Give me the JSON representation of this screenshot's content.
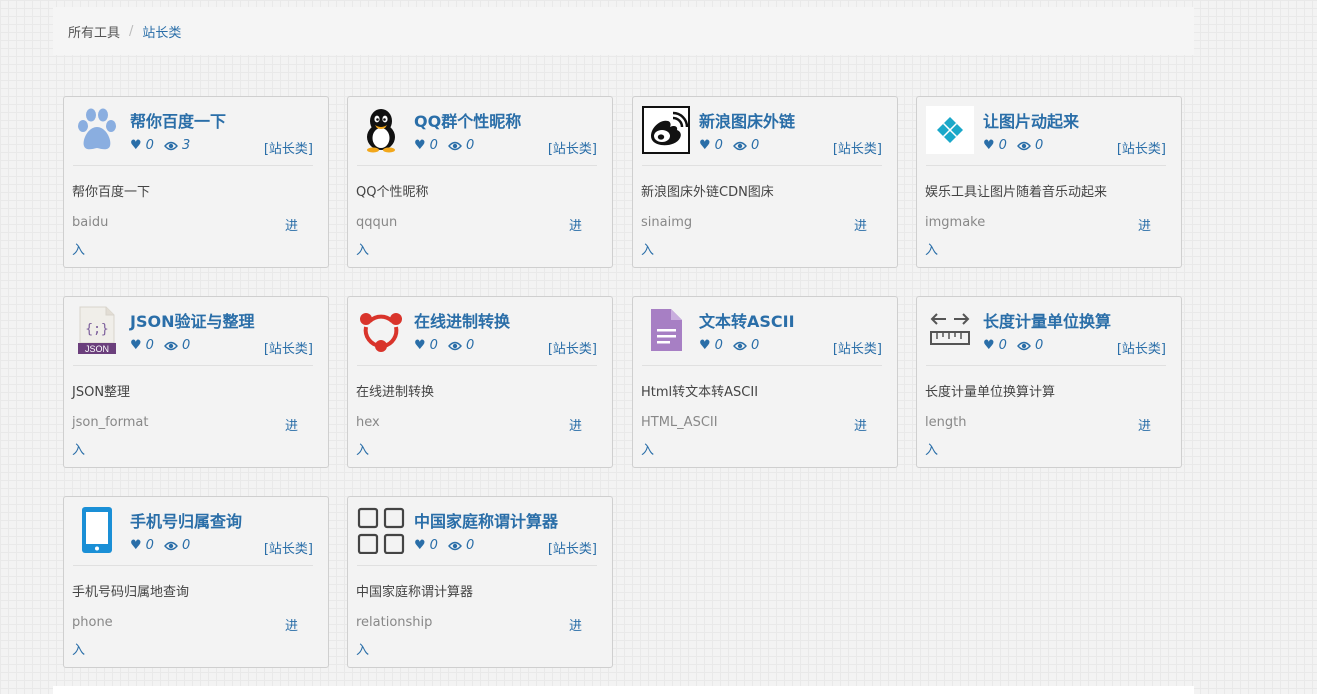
{
  "breadcrumb": {
    "root": "所有工具",
    "separator": "/",
    "current": "站长类"
  },
  "enter_label": [
    "进",
    "入"
  ],
  "tools": [
    {
      "title": "帮你百度一下",
      "likes": "0",
      "views": "3",
      "category": "[站长类]",
      "desc": "帮你百度一下",
      "slug": "baidu",
      "icon": "baidu-paw-icon"
    },
    {
      "title": "QQ群个性昵称",
      "likes": "0",
      "views": "0",
      "category": "[站长类]",
      "desc": "QQ个性昵称",
      "slug": "qqqun",
      "icon": "qq-penguin-icon"
    },
    {
      "title": "新浪图床外链",
      "likes": "0",
      "views": "0",
      "category": "[站长类]",
      "desc": "新浪图床外链CDN图床",
      "slug": "sinaimg",
      "icon": "weibo-icon"
    },
    {
      "title": "让图片动起来",
      "likes": "0",
      "views": "0",
      "category": "[站长类]",
      "desc": "娱乐工具让图片随着音乐动起来",
      "slug": "imgmake",
      "icon": "diamond-icon"
    },
    {
      "title": "JSON验证与整理",
      "likes": "0",
      "views": "0",
      "category": "[站长类]",
      "desc": "JSON整理",
      "slug": "json_format",
      "icon": "json-file-icon",
      "icon_text": "JSON",
      "icon_braces": "{;}"
    },
    {
      "title": "在线进制转换",
      "likes": "0",
      "views": "0",
      "category": "[站长类]",
      "desc": "在线进制转换",
      "slug": "hex",
      "icon": "share-triangle-icon"
    },
    {
      "title": "文本转ASCII",
      "likes": "0",
      "views": "0",
      "category": "[站长类]",
      "desc": "Html转文本转ASCII",
      "slug": "HTML_ASCII",
      "icon": "document-icon"
    },
    {
      "title": "长度计量单位换算",
      "likes": "0",
      "views": "0",
      "category": "[站长类]",
      "desc": "长度计量单位换算计算",
      "slug": "length",
      "icon": "ruler-icon"
    },
    {
      "title": "手机号归属查询",
      "likes": "0",
      "views": "0",
      "category": "[站长类]",
      "desc": "手机号码归属地查询",
      "slug": "phone",
      "icon": "mobile-phone-icon"
    },
    {
      "title": "中国家庭称谓计算器",
      "likes": "0",
      "views": "0",
      "category": "[站长类]",
      "desc": "中国家庭称谓计算器",
      "slug": "relationship",
      "icon": "grid-squares-icon"
    }
  ],
  "colors": {
    "link": "#2a6ea8",
    "baidu": "#8aaee0",
    "hex_red": "#d9342b",
    "doc_purple": "#a77fc4",
    "phone_blue": "#1a8fd6",
    "diamond": "#1aa8c9"
  }
}
